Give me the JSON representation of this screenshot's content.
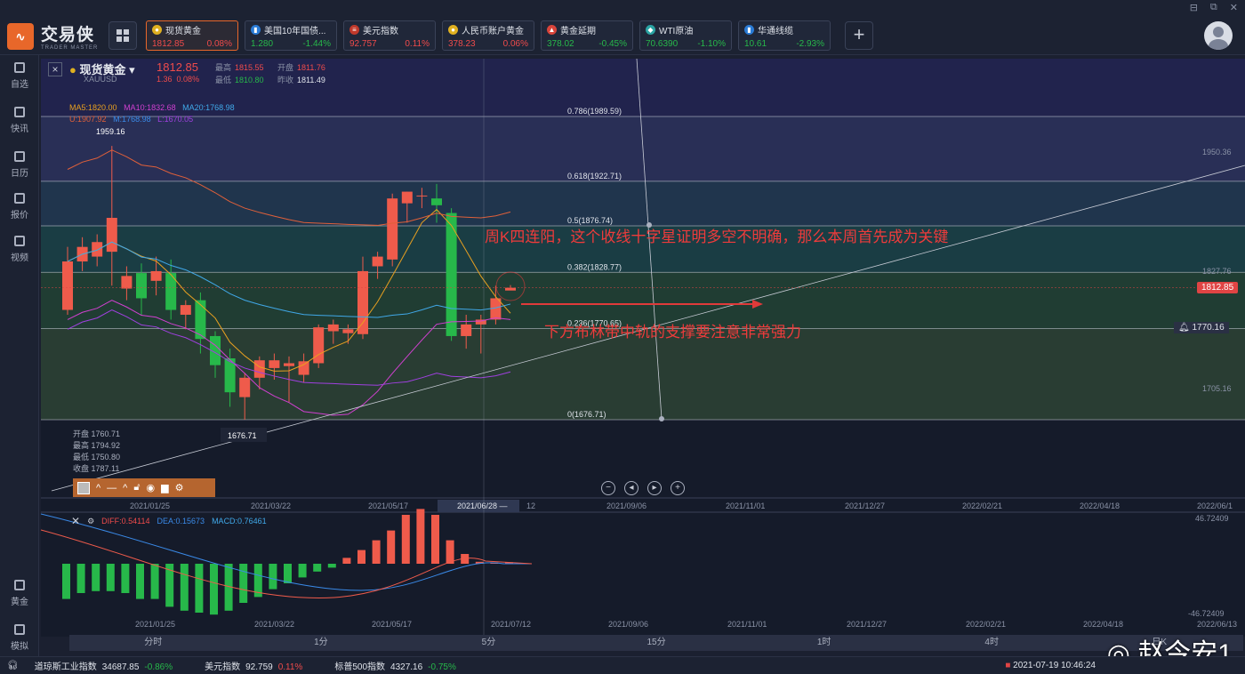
{
  "app": {
    "name": "交易侠",
    "sub": "TRADER MASTER",
    "window_controls": [
      "⊟",
      "⧉",
      "✕"
    ]
  },
  "tickers": [
    {
      "name": "现货黄金",
      "price": "1812.85",
      "change": "0.08%",
      "dir": "up",
      "badge_color": "#e0b020",
      "badge": "●"
    },
    {
      "name": "美国10年国债...",
      "price": "1.280",
      "change": "-1.44%",
      "dir": "down",
      "badge_color": "#2a7bd6",
      "badge": "▮"
    },
    {
      "name": "美元指数",
      "price": "92.757",
      "change": "0.11%",
      "dir": "up",
      "badge_color": "#c0392b",
      "badge": "≡"
    },
    {
      "name": "人民币账户黄金",
      "price": "378.23",
      "change": "0.06%",
      "dir": "up",
      "badge_color": "#e0b020",
      "badge": "●"
    },
    {
      "name": "黄金延期",
      "price": "378.02",
      "change": "-0.45%",
      "dir": "down",
      "badge_color": "#d9443a",
      "badge": "▲"
    },
    {
      "name": "WTI原油",
      "price": "70.6390",
      "change": "-1.10%",
      "dir": "down",
      "badge_color": "#2aa3a3",
      "badge": "◆"
    },
    {
      "name": "华通线缆",
      "price": "10.61",
      "change": "-2.93%",
      "dir": "down",
      "badge_color": "#2a7bd6",
      "badge": "▮"
    }
  ],
  "sidebar": [
    {
      "label": "自选",
      "icon": "bookmark-icon"
    },
    {
      "label": "快讯",
      "icon": "news-icon"
    },
    {
      "label": "日历",
      "icon": "calendar-icon"
    },
    {
      "label": "报价",
      "icon": "chart-icon"
    },
    {
      "label": "视频",
      "icon": "video-icon"
    },
    {
      "label": "黄金",
      "icon": "gold-icon"
    },
    {
      "label": "模拟",
      "icon": "wallet-icon"
    }
  ],
  "symbol": {
    "name": "现货黄金",
    "code": "XAUUSD",
    "price": "1812.85",
    "change": "1.36",
    "change_pct": "0.08%",
    "high_label": "最高",
    "high": "1815.55",
    "open_label": "开盘",
    "open": "1811.76",
    "low_label": "最低",
    "low": "1810.80",
    "prev_label": "昨收",
    "prev": "1811.49"
  },
  "indicators": {
    "ma5": "MA5:1820.00",
    "ma10": "MA10:1832.68",
    "ma20": "MA20:1768.98",
    "boll_u": "U:1907.92",
    "boll_m": "M:1768.98",
    "boll_l": "L:1670.05",
    "ma_colors": {
      "ma5": "#e8a020",
      "ma10": "#d040d0",
      "ma20": "#40a8e8",
      "boll_u": "#e0603a",
      "boll_m": "#3a8ae8",
      "boll_l": "#a040e0"
    }
  },
  "fib_levels": [
    {
      "label": "0.786(1989.59)",
      "price": 1989.59
    },
    {
      "label": "0.618(1922.71)",
      "price": 1922.71
    },
    {
      "label": "0.5(1876.74)",
      "price": 1876.74
    },
    {
      "label": "0.382(1828.77)",
      "price": 1828.77
    },
    {
      "label": "0.236(1770.65)",
      "price": 1770.65
    },
    {
      "label": "0(1676.71)",
      "price": 1676.71
    }
  ],
  "price_axis": {
    "ticks": [
      "1950.36",
      "1827.76",
      "1705.16"
    ],
    "current": "1812.85",
    "alert": "1770.16"
  },
  "annotations": {
    "top": "周K四连阳，这个收线十字星证明多空不明确，那么本周首先成为关键",
    "bottom": "下方布林带中轨的支撑要注意非常强力"
  },
  "labels": {
    "high_mark": "1959.16",
    "low_mark": "1676.71"
  },
  "ohlc_box": [
    "开盘 1760.71",
    "最高 1794.92",
    "最低 1750.80",
    "收盘 1787.11"
  ],
  "x_axis": [
    "2021/01/25",
    "2021/03/22",
    "2021/05/17",
    "2021/06/28 —",
    "12",
    "2021/09/06",
    "2021/11/01",
    "2021/12/27",
    "2022/02/21",
    "2022/04/18",
    "2022/06/1"
  ],
  "x_axis_macd": [
    "2021/01/25",
    "2021/03/22",
    "2021/05/17",
    "2021/07/12",
    "2021/09/06",
    "2021/11/01",
    "2021/12/27",
    "2022/02/21",
    "2022/04/18",
    "2022/06/13"
  ],
  "macd": {
    "diff": "DIFF:0.54114",
    "dea": "DEA:0.15673",
    "macd": "MACD:0.76461",
    "axis_top": "46.72409",
    "axis_bottom": "-46.72409"
  },
  "timeframes": [
    "分时",
    "1分",
    "5分",
    "15分",
    "1时",
    "4时",
    "日K"
  ],
  "status": [
    {
      "name": "道琼斯工业指数",
      "price": "34687.85",
      "change": "-0.86%",
      "dir": "down"
    },
    {
      "name": "美元指数",
      "price": "92.759",
      "change": "0.11%",
      "dir": "up"
    },
    {
      "name": "标普500指数",
      "price": "4327.16",
      "change": "-0.75%",
      "dir": "down"
    }
  ],
  "datetime": "2021-07-19 10:46:24",
  "watermark": "赵今安1",
  "chart_data": {
    "type": "candlestick",
    "title": "",
    "candles": [
      {
        "o": 1790,
        "c": 1840,
        "h": 1855,
        "l": 1785
      },
      {
        "o": 1840,
        "c": 1855,
        "h": 1865,
        "l": 1830
      },
      {
        "o": 1845,
        "c": 1860,
        "h": 1868,
        "l": 1835
      },
      {
        "o": 1850,
        "c": 1885,
        "h": 1959.16,
        "l": 1815
      },
      {
        "o": 1812,
        "c": 1825,
        "h": 1835,
        "l": 1800
      },
      {
        "o": 1828,
        "c": 1802,
        "h": 1838,
        "l": 1785
      },
      {
        "o": 1820,
        "c": 1830,
        "h": 1845,
        "l": 1805
      },
      {
        "o": 1828,
        "c": 1790,
        "h": 1842,
        "l": 1780
      },
      {
        "o": 1785,
        "c": 1795,
        "h": 1800,
        "l": 1770
      },
      {
        "o": 1800,
        "c": 1760,
        "h": 1808,
        "l": 1745
      },
      {
        "o": 1763,
        "c": 1733,
        "h": 1768,
        "l": 1720
      },
      {
        "o": 1740,
        "c": 1705,
        "h": 1750,
        "l": 1690
      },
      {
        "o": 1700,
        "c": 1720,
        "h": 1725,
        "l": 1676.71
      },
      {
        "o": 1720,
        "c": 1738,
        "h": 1742,
        "l": 1708
      },
      {
        "o": 1730,
        "c": 1738,
        "h": 1745,
        "l": 1718
      },
      {
        "o": 1732,
        "c": 1735,
        "h": 1742,
        "l": 1695
      },
      {
        "o": 1723,
        "c": 1737,
        "h": 1745,
        "l": 1715
      },
      {
        "o": 1735,
        "c": 1772,
        "h": 1775,
        "l": 1730
      },
      {
        "o": 1768,
        "c": 1775,
        "h": 1780,
        "l": 1755
      },
      {
        "o": 1766,
        "c": 1770,
        "h": 1775,
        "l": 1755
      },
      {
        "o": 1765,
        "c": 1830,
        "h": 1845,
        "l": 1760
      },
      {
        "o": 1835,
        "c": 1845,
        "h": 1850,
        "l": 1822
      },
      {
        "o": 1842,
        "c": 1905,
        "h": 1910,
        "l": 1835
      },
      {
        "o": 1900,
        "c": 1912,
        "h": 1912,
        "l": 1880
      },
      {
        "o": 1908,
        "c": 1908,
        "h": 1916,
        "l": 1895
      },
      {
        "o": 1905,
        "c": 1898,
        "h": 1920,
        "l": 1880
      },
      {
        "o": 1890,
        "c": 1763,
        "h": 1895,
        "l": 1758
      },
      {
        "o": 1763,
        "c": 1775,
        "h": 1785,
        "l": 1750
      },
      {
        "o": 1775,
        "c": 1780,
        "h": 1785,
        "l": 1745
      },
      {
        "o": 1780,
        "c": 1802,
        "h": 1815,
        "l": 1775
      },
      {
        "o": 1810,
        "c": 1812.85,
        "h": 1815.55,
        "l": 1810.8
      }
    ],
    "macd_hist": [
      -18,
      -15,
      -14,
      -14,
      -15,
      -18,
      -18,
      -22,
      -24,
      -25,
      -26,
      -24,
      -20,
      -17,
      -13,
      -10,
      -7,
      -4,
      -2,
      3,
      7,
      12,
      17,
      25,
      28,
      25,
      12,
      5,
      1,
      0.5,
      0.76
    ]
  }
}
